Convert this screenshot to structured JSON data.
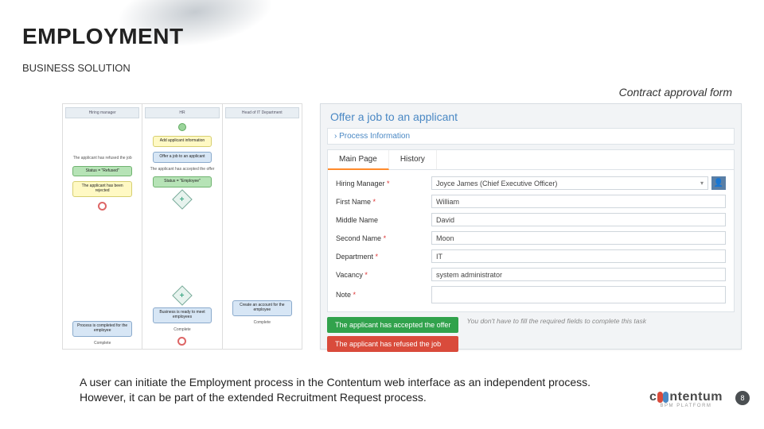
{
  "title": "EMPLOYMENT",
  "subtitle": "BUSINESS SOLUTION",
  "caption": "Contract approval form",
  "diagram": {
    "lanes": [
      {
        "header": "Hiring manager",
        "label_rejected": "The applicant has refused the job",
        "nodes": [
          "",
          "Status = \"Refused\"",
          "The applicant has been rejected"
        ]
      },
      {
        "header": "HR",
        "nodes": [
          "Add applicant information",
          "Offer a job to an applicant",
          "Status = \"Employee\"",
          "Complete"
        ],
        "label_wait": "The applicant has accepted the offer"
      },
      {
        "header": "Head of IT Department",
        "nodes": [
          "Process is completed for the employee",
          "Business is ready to meet employees",
          "Create an account for the employee"
        ]
      }
    ]
  },
  "form": {
    "title": "Offer a job to an applicant",
    "accordion": "› Process Information",
    "tabs": [
      "Main Page",
      "History"
    ],
    "fields": {
      "hiring_manager": {
        "label": "Hiring Manager",
        "value": "Joyce James (Chief Executive Officer)"
      },
      "first_name": {
        "label": "First Name",
        "value": "William"
      },
      "middle_name": {
        "label": "Middle Name",
        "value": "David"
      },
      "second_name": {
        "label": "Second Name",
        "value": "Moon"
      },
      "department": {
        "label": "Department",
        "value": "IT"
      },
      "vacancy": {
        "label": "Vacancy",
        "value": "system administrator"
      },
      "note": {
        "label": "Note",
        "value": ""
      }
    },
    "buttons": {
      "accept": "The applicant has accepted the offer",
      "refuse": "The applicant has refused the job"
    },
    "footer_note": "You don't have to fill the required fields to complete this task"
  },
  "description": "A user can initiate the Employment process in the Contentum web interface as an independent process. However, it can be part of the extended Recruitment Request process.",
  "logo": {
    "brand_left": "c",
    "brand_right": "ntentum",
    "sub": "BPM PLATFORM"
  },
  "page_number": "8"
}
